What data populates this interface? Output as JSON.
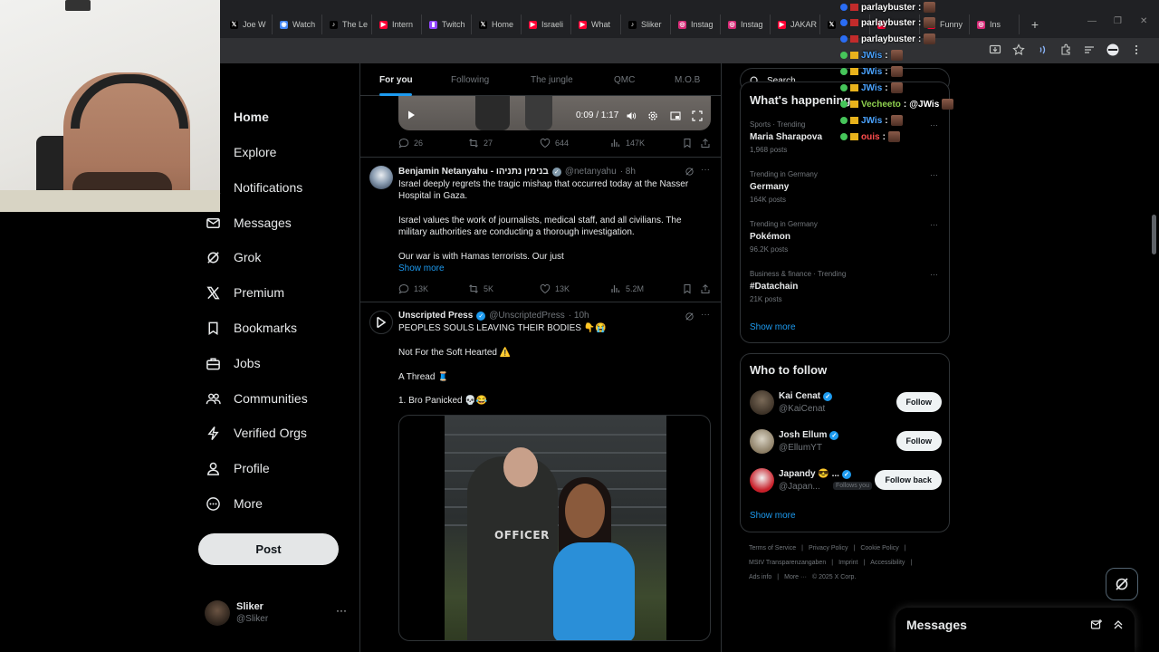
{
  "browser": {
    "tabs": [
      {
        "icon": "x-icon",
        "label": "Joe W",
        "color": "#000000"
      },
      {
        "icon": "watch-icon",
        "label": "Watch",
        "color": "#4285f4"
      },
      {
        "icon": "tiktok-icon",
        "label": "The Le",
        "color": "#000000"
      },
      {
        "icon": "youtube-icon",
        "label": "Intern",
        "color": "#ff0033"
      },
      {
        "icon": "twitch-icon",
        "label": "Twitch",
        "color": "#9146ff"
      },
      {
        "icon": "x-icon",
        "label": "Home",
        "color": "#000000"
      },
      {
        "icon": "youtube-icon",
        "label": "Israeli",
        "color": "#ff0033"
      },
      {
        "icon": "youtube-icon",
        "label": "What",
        "color": "#ff0033"
      },
      {
        "icon": "tiktok-icon",
        "label": "Sliker",
        "color": "#000000"
      },
      {
        "icon": "instagram-icon",
        "label": "Instag",
        "color": "#d62976"
      },
      {
        "icon": "instagram-icon",
        "label": "Instag",
        "color": "#d62976"
      },
      {
        "icon": "youtube-icon",
        "label": "JAKAR",
        "color": "#ff0033"
      },
      {
        "icon": "x-icon",
        "label": "",
        "color": "#000000"
      },
      {
        "icon": "youtube-icon",
        "label": "",
        "color": "#ff0033"
      },
      {
        "icon": "youtube-icon",
        "label": "Funny",
        "color": "#ff0033"
      },
      {
        "icon": "instagram-icon",
        "label": "Ins",
        "color": "#d62976"
      }
    ],
    "new_tab": "+"
  },
  "nav": {
    "items": [
      {
        "name": "home",
        "label": "Home",
        "icon": "home-icon"
      },
      {
        "name": "explore",
        "label": "Explore",
        "icon": "search-icon"
      },
      {
        "name": "notifications",
        "label": "Notifications",
        "icon": "bell-icon"
      },
      {
        "name": "messages",
        "label": "Messages",
        "icon": "envelope-icon"
      },
      {
        "name": "grok",
        "label": "Grok",
        "icon": "grok-icon"
      },
      {
        "name": "premium",
        "label": "Premium",
        "icon": "x-logo-icon"
      },
      {
        "name": "bookmarks",
        "label": "Bookmarks",
        "icon": "bookmark-icon"
      },
      {
        "name": "jobs",
        "label": "Jobs",
        "icon": "briefcase-icon"
      },
      {
        "name": "communities",
        "label": "Communities",
        "icon": "people-icon"
      },
      {
        "name": "verified-orgs",
        "label": "Verified Orgs",
        "icon": "lightning-icon"
      },
      {
        "name": "profile",
        "label": "Profile",
        "icon": "person-icon"
      },
      {
        "name": "more",
        "label": "More",
        "icon": "more-circle-icon"
      }
    ],
    "post_button": "Post",
    "account": {
      "name": "Sliker",
      "handle": "@Sliker",
      "more": "···"
    }
  },
  "feed": {
    "tabs": [
      "For you",
      "Following",
      "The jungle",
      "QMC",
      "M.O.B"
    ],
    "video": {
      "time": "0:09 / 1:17"
    },
    "tweet0_actions": {
      "replies": "26",
      "reposts": "27",
      "likes": "644",
      "views": "147K"
    },
    "tweet1": {
      "name": "Benjamin Netanyahu - בנימין נתניהו",
      "handle": "@netanyahu",
      "time": "· 8h",
      "lines": [
        "Israel deeply regrets the tragic mishap that occurred today at the Nasser",
        "Hospital in Gaza.",
        "Israel values the work of journalists, medical staff, and all civilians. The",
        "military authorities are conducting a thorough investigation.",
        "Our war is with Hamas terrorists. Our just"
      ],
      "show_more": "Show more",
      "actions": {
        "replies": "13K",
        "reposts": "5K",
        "likes": "13K",
        "views": "5.2M"
      },
      "verified_color": "#829aab"
    },
    "tweet2": {
      "name": "Unscripted Press",
      "handle": "@UnscriptedPress",
      "time": "· 10h",
      "lines": [
        "PEOPLES SOULS LEAVING THEIR BODIES 👇😭",
        "Not For the Soft Hearted ⚠️",
        "A Thread 🧵",
        "1. Bro Panicked 💀😂"
      ],
      "photo_text": "OFFICER",
      "verified_color": "#1d9bf0"
    }
  },
  "sidebar": {
    "search_placeholder": "Search",
    "happening_title": "What's happening",
    "trends": [
      {
        "context": "Sports · Trending",
        "name": "Maria Sharapova",
        "count": "1,968 posts"
      },
      {
        "context": "Trending in Germany",
        "name": "Germany",
        "count": "164K posts"
      },
      {
        "context": "Trending in Germany",
        "name": "Pokémon",
        "count": "96.2K posts"
      },
      {
        "context": "Business & finance · Trending",
        "name": "#Datachain",
        "count": "21K posts"
      }
    ],
    "trend_more": "···",
    "show_more": "Show more",
    "who_to_follow_title": "Who to follow",
    "follow_suggestions": [
      {
        "name": "Kai Cenat",
        "handle": "@KaiCenat",
        "button": "Follow",
        "follows_you": ""
      },
      {
        "name": "Josh Ellum",
        "handle": "@EllumYT",
        "button": "Follow",
        "follows_you": ""
      },
      {
        "name": "Japandy 😎 ...",
        "handle": "@Japan...",
        "button": "Follow back",
        "follows_you": "Follows you"
      }
    ],
    "footer_line1": [
      "Terms of Service",
      "|",
      "Privacy Policy",
      "|",
      "Cookie Policy",
      "|"
    ],
    "footer_line2": [
      "MStV Transparenzangaben",
      "|",
      "Imprint",
      "|",
      "Accessibility",
      "|"
    ],
    "footer_line3": [
      "Ads info",
      "|",
      "More ···",
      "© 2025 X Corp."
    ]
  },
  "messages_drawer": {
    "title": "Messages"
  },
  "chat_overlay": [
    {
      "user": "parlaybuster",
      "message": "",
      "color": "#ffffff"
    },
    {
      "user": "parlaybuster",
      "message": "",
      "color": "#ffffff"
    },
    {
      "user": "parlaybuster",
      "message": "",
      "color": "#ffffff"
    },
    {
      "user": "JWis",
      "message": "",
      "color": "#4aa3ff"
    },
    {
      "user": "JWis",
      "message": "",
      "color": "#4aa3ff"
    },
    {
      "user": "JWis",
      "message": "",
      "color": "#4aa3ff"
    },
    {
      "user": "Vecheeto",
      "message": "@JWis",
      "color": "#8fd14f"
    },
    {
      "user": "JWis",
      "message": "",
      "color": "#4aa3ff"
    },
    {
      "user": "ouis",
      "message": "",
      "color": "#ff4d4d"
    }
  ],
  "colors": {
    "accent": "#1d9bf0",
    "background": "#000000",
    "border": "#2f3336"
  }
}
